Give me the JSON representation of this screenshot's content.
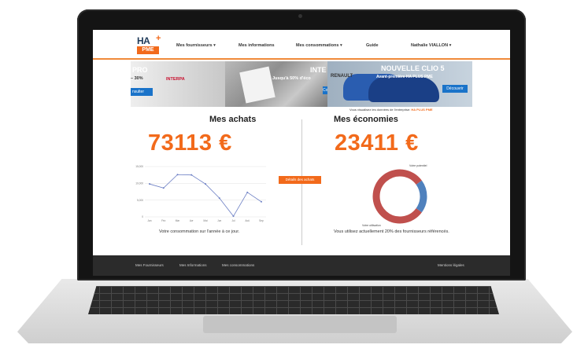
{
  "nav": {
    "items": [
      {
        "label": "Mes fournisseurs",
        "caret": "▾"
      },
      {
        "label": "Mes informations",
        "caret": ""
      },
      {
        "label": "Mes consommations",
        "caret": "▾"
      },
      {
        "label": "Guide",
        "caret": ""
      },
      {
        "label": "Nathalie VIALLON",
        "caret": "▾"
      }
    ]
  },
  "logo": {
    "top": "HA",
    "bottom": "PME",
    "plus": "+"
  },
  "banner": {
    "slide1_title": "PRO",
    "slide1_discount": "– 30%",
    "slide1_brand": "INTERPA",
    "slide1_button": "nsulter",
    "slide2_title": "INTE",
    "slide2_text": "Jusqu'à 50% d'éco",
    "slide2_button": "Co",
    "slide3_brand": "RENAULT",
    "slide3_title": "NOUVELLE CLIO 5",
    "slide3_text": "Avant-première HA PLUS PME",
    "slide3_button": "Découvrir"
  },
  "context": {
    "label": "Vous visualisez les données de l'entreprise:",
    "company": "HA PLUS PME"
  },
  "achats": {
    "title": "Mes achats",
    "amount": "73113 €",
    "caption": "Votre consommation sur l'année à ce jour."
  },
  "economies": {
    "title": "Mes économies",
    "amount": "23411 €",
    "caption": "Vous utilisez actuellement 20% des fournisseurs référencés."
  },
  "details_button": "Détails des achats",
  "chart_data": [
    {
      "type": "line",
      "x": [
        "Jan",
        "Fév",
        "Mar",
        "Avr",
        "Mai",
        "Jun",
        "Jul",
        "Aoû",
        "Sep"
      ],
      "y": [
        9800,
        8600,
        12600,
        12500,
        9800,
        5600,
        200,
        7300,
        4500
      ],
      "ylim": [
        0,
        15000
      ],
      "yticks": [
        "15,000",
        "10,000",
        "5,000",
        "0"
      ],
      "color": "#6c7fc4",
      "grid": true
    },
    {
      "type": "pie",
      "labels": [
        "Votre potentiel",
        "Votre utilisation"
      ],
      "values": [
        80,
        20
      ],
      "colors": [
        "#c0504d",
        "#4f81bd"
      ],
      "donut": true
    }
  ],
  "footer": {
    "links": [
      "Mes Fournisseurs",
      "Mes Informations",
      "Mes consommations"
    ],
    "legal": "Mentions légales"
  },
  "colors": {
    "accent": "#f26a1b",
    "footer": "#2b2b2b",
    "line": "#6c7fc4",
    "donut_red": "#c0504d",
    "donut_blue": "#4f81bd"
  }
}
